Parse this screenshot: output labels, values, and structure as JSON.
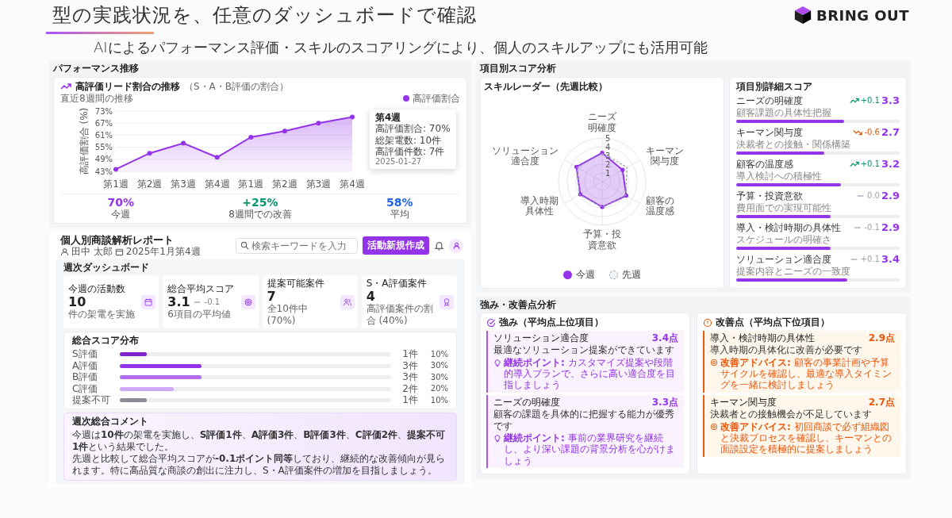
{
  "slide": {
    "title": "型の実践状況を、任意のダッシュボードで確認",
    "logo": "BRING OUT",
    "subtitle": "AIによるパフォーマンス評価・スキルのスコアリングにより、個人のスキルアップにも活用可能"
  },
  "performance": {
    "section_title": "パフォーマンス推移",
    "card_title": "高評価リード割合の推移",
    "card_note": "（S・A・B評価の割合）",
    "caption": "直近8週間の推移",
    "chart_data": {
      "type": "area",
      "ylabel": "高評価割合 (%)",
      "categories": [
        "第1週",
        "第2週",
        "第3週",
        "第4週",
        "第1週",
        "第2週",
        "第3週",
        "第4週"
      ],
      "series": [
        {
          "name": "高評価割合",
          "color": "#9333ea",
          "values": [
            44,
            52,
            57,
            50,
            60,
            63,
            67,
            70
          ]
        }
      ],
      "ylim": [
        43,
        73
      ],
      "yticks": [
        {
          "value": 43,
          "label": "43%"
        },
        {
          "value": 49,
          "label": "49%"
        },
        {
          "value": 55,
          "label": "55%"
        },
        {
          "value": 61,
          "label": "61%"
        },
        {
          "value": 67,
          "label": "67%"
        },
        {
          "value": 73,
          "label": "73%"
        }
      ],
      "grid": true,
      "legend": "top-right"
    },
    "tooltip": {
      "title": "第4週",
      "lines": [
        "高評価割合: 70%",
        "総架電数: 10件",
        "高評価件数: 7件"
      ],
      "date": "2025-01-27"
    },
    "stats": [
      {
        "value": "70%",
        "label": "今週",
        "color": "#9333ea"
      },
      {
        "value": "+25%",
        "label": "8週間での改善",
        "color": "#059669"
      },
      {
        "value": "58%",
        "label": "平均",
        "color": "#2563eb"
      }
    ]
  },
  "report": {
    "title": "個人別商談解析レポート",
    "user": "田中 太郎",
    "date": "2025年1月第4週",
    "search_placeholder": "検索キーワードを入力",
    "new_button": "活動新規作成",
    "dashboard_title": "週次ダッシュボード",
    "kpis": [
      {
        "label": "今週の活動数",
        "value": "10",
        "sub": "件の架電を実施"
      },
      {
        "label": "総合平均スコア",
        "value": "3.1",
        "delta": "-0.1",
        "sub": "6項目の平均値"
      },
      {
        "label": "提案可能案件",
        "value": "7",
        "sub": "全10件中 (70%)"
      },
      {
        "label": "S・A評価案件",
        "value": "4",
        "sub": "高評価案件の割合 (40%)"
      }
    ],
    "distribution": {
      "title": "総合スコア分布",
      "rows": [
        {
          "label": "S評価",
          "count": "1件",
          "percent": "10%",
          "level": 0.1,
          "color": "#7e22ce"
        },
        {
          "label": "A評価",
          "count": "3件",
          "percent": "30%",
          "level": 0.3,
          "color": "#9333ea"
        },
        {
          "label": "B評価",
          "count": "3件",
          "percent": "30%",
          "level": 0.3,
          "color": "#b46cf2"
        },
        {
          "label": "C評価",
          "count": "2件",
          "percent": "20%",
          "level": 0.2,
          "color": "#d0a8f5"
        },
        {
          "label": "提案不可",
          "count": "1件",
          "percent": "10%",
          "level": 0.1,
          "color": "#8b8b95"
        }
      ]
    },
    "comment": {
      "title": "週次総合コメント",
      "paragraphs": [
        "今週は**10件**の架電を実施し、**S評価1件**、**A評価3件**、**B評価3件**、**C評価2件**、**提案不可1件**という結果でした。",
        "先週と比較して総合平均スコアが**-0.1ポイント同等**しており、継続的な改善傾向が見られます。特に高品質な商談の創出に注力し、S・A評価案件の増加を目指しましょう。"
      ]
    }
  },
  "scores": {
    "section_title": "項目別スコア分析",
    "radar": {
      "title": "スキルレーダー（先週比較）",
      "chart_data": {
        "type": "radar",
        "categories": [
          "ニーズ明確度",
          "キーマン関与度",
          "顧客の温度感",
          "予算・投資意欲",
          "導入時期具体性",
          "ソリューション適合度"
        ],
        "series": [
          {
            "name": "今週",
            "color": "#9333ea",
            "values": [
              3.3,
              2.7,
              3.2,
              2.9,
              2.9,
              3.4
            ]
          },
          {
            "name": "先週",
            "color": "#9ca3af",
            "values": [
              3.2,
              3.3,
              3.1,
              2.9,
              3.0,
              3.3
            ]
          }
        ],
        "ylim": [
          0,
          5
        ],
        "yticks": [
          1,
          2,
          3,
          4,
          5
        ],
        "grid": true,
        "legend": "bottom"
      }
    },
    "detail": {
      "title": "項目別詳細スコア",
      "items": [
        {
          "name": "ニーズの明確度",
          "sub": "顧客課題の具体性把握",
          "kind": "up",
          "delta": "+0.1",
          "score": "3.3",
          "level": 0.66
        },
        {
          "name": "キーマン関与度",
          "sub": "決裁者との接触・関係構築",
          "kind": "down",
          "delta": "-0.6",
          "score": "2.7",
          "level": 0.54
        },
        {
          "name": "顧客の温度感",
          "sub": "導入検討への積極性",
          "kind": "up",
          "delta": "+0.1",
          "score": "3.2",
          "level": 0.64
        },
        {
          "name": "予算・投資意欲",
          "sub": "費用面での実現可能性",
          "kind": "flat",
          "delta": "0.0",
          "score": "2.9",
          "level": 0.58
        },
        {
          "name": "導入・検討時期の具体性",
          "sub": "スケジュールの明確さ",
          "kind": "flat",
          "delta": "-0.1",
          "score": "2.9",
          "level": 0.58
        },
        {
          "name": "ソリューション適合度",
          "sub": "提案内容とニーズの一致度",
          "kind": "flat",
          "delta": "+0.1",
          "score": "3.4",
          "level": 0.68
        }
      ]
    }
  },
  "analysis": {
    "section_title": "強み・改善点分析",
    "panels": [
      {
        "kind": "strength",
        "title": "強み（平均点上位項目）",
        "items": [
          {
            "name": "ソリューション適合度",
            "score": "3.4点",
            "description": "最適なソリューション提案ができています",
            "advice": "**継続ポイント:** カスタマイズ提案や段階的導入プランで、さらに高い適合度を目指しましょう"
          },
          {
            "name": "ニーズの明確度",
            "score": "3.3点",
            "description": "顧客の課題を具体的に把握する能力が優秀です",
            "advice": "**継続ポイント:** 事前の業界研究を継続し、より深い課題の背景分析を心がけましょう"
          }
        ]
      },
      {
        "kind": "improvement",
        "title": "改善点（平均点下位項目）",
        "items": [
          {
            "name": "導入・検討時期の具体性",
            "score": "2.9点",
            "description": "導入時期の具体化に改善が必要です",
            "advice": "**改善アドバイス:** 顧客の事業計画や予算サイクルを確認し、最適な導入タイミングを一緒に検討しましょう"
          },
          {
            "name": "キーマン関与度",
            "score": "2.7点",
            "description": "決裁者との接触機会が不足しています",
            "advice": "**改善アドバイス:** 初回商談で必ず組織図と決裁プロセスを確認し、キーマンとの面談設定を積極的に提案しましょう"
          }
        ]
      }
    ]
  }
}
